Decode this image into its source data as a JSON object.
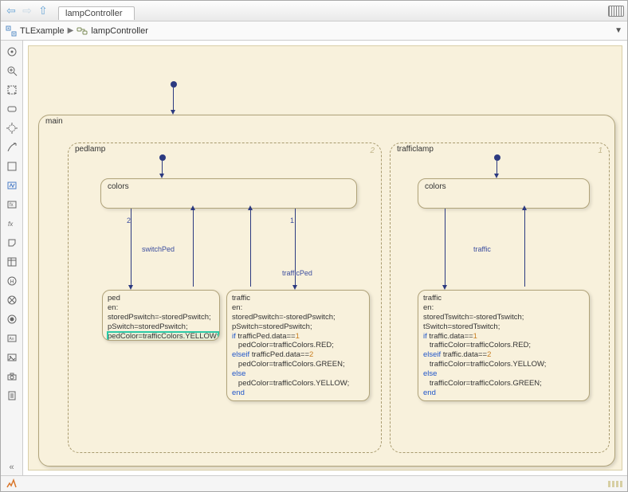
{
  "tab": {
    "label": "lampController"
  },
  "breadcrumb": {
    "root": "TLExample",
    "leaf": "lampController"
  },
  "main": {
    "label": "main"
  },
  "pedlamp": {
    "label": "pedlamp",
    "num": "2",
    "colors": "colors",
    "left_order": "2",
    "right_order": "1",
    "switchPed": "switchPed",
    "trafficPed": "trafficPed",
    "ped": {
      "title": "ped",
      "l1": "en:",
      "l2": "storedPswitch=-storedPswitch;",
      "l3": "pSwitch=storedPswitch;",
      "l4": "pedColor=trafficColors.YELLOW;"
    },
    "traffic": {
      "title": "traffic",
      "l1": "en:",
      "l2": "storedPswitch=-storedPswitch;",
      "l3": "pSwitch=storedPswitch;",
      "kw_if": "if",
      "c1": " trafficPed.data==",
      "n1": "1",
      "l5": "   pedColor=trafficColors.RED;",
      "kw_elseif": "elseif",
      "c2": " trafficPed.data==",
      "n2": "2",
      "l7": "   pedColor=trafficColors.GREEN;",
      "kw_else": "else",
      "l9": "   pedColor=trafficColors.YELLOW;",
      "kw_end": "end"
    }
  },
  "trafficlamp": {
    "label": "trafficlamp",
    "num": "1",
    "colors": "colors",
    "trafficLbl": "traffic",
    "traffic": {
      "title": "traffic",
      "l1": "en:",
      "l2": "storedTswitch=-storedTswitch;",
      "l3": "tSwitch=storedTswitch;",
      "kw_if": "if",
      "c1": " traffic.data==",
      "n1": "1",
      "l5": "   trafficColor=trafficColors.RED;",
      "kw_elseif": "elseif",
      "c2": " traffic.data==",
      "n2": "2",
      "l7": "   trafficColor=trafficColors.YELLOW;",
      "kw_else": "else",
      "l9": "   trafficColor=trafficColors.GREEN;",
      "kw_end": "end"
    }
  }
}
